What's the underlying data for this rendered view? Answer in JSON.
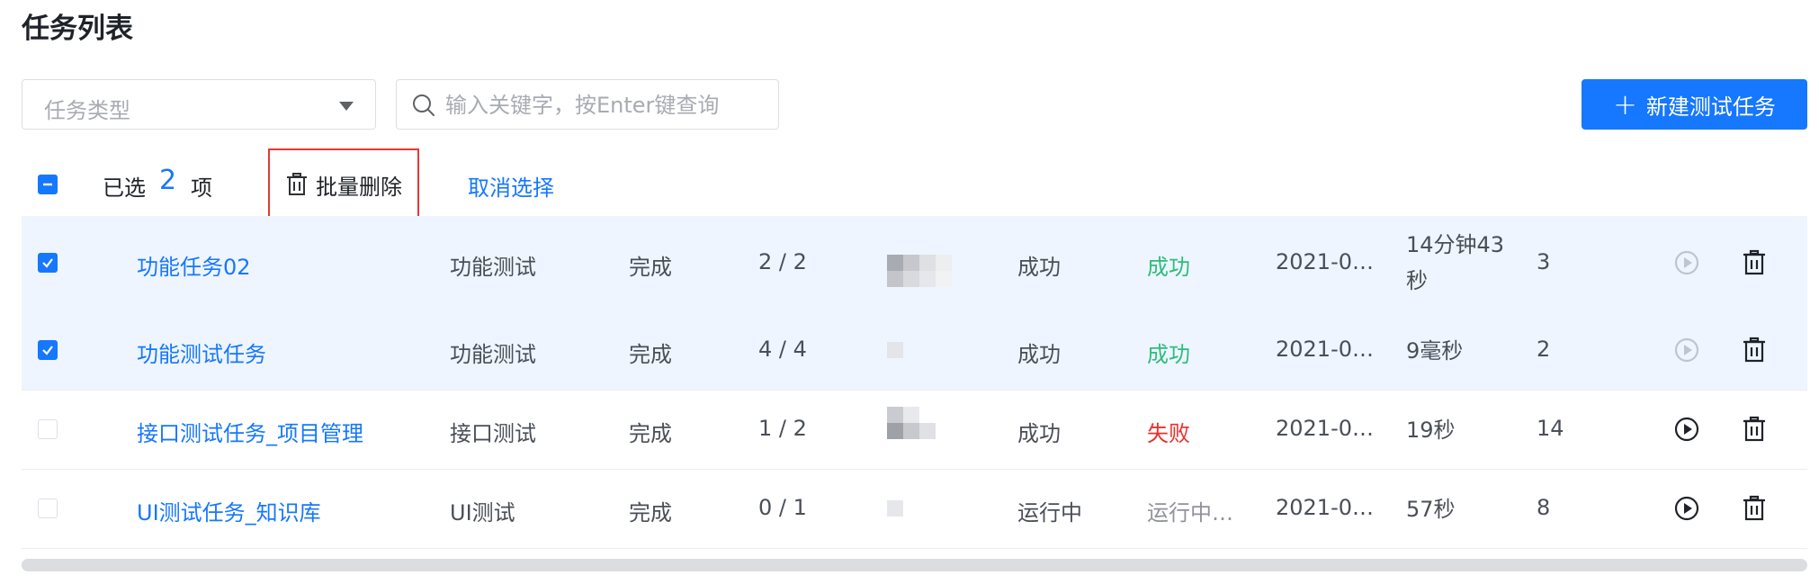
{
  "page": {
    "title": "任务列表"
  },
  "filters": {
    "task_type_placeholder": "任务类型",
    "search_placeholder": "输入关键字，按Enter键查询",
    "new_button_label": "新建测试任务"
  },
  "selection": {
    "prefix": "已选",
    "count": "2",
    "suffix": "项",
    "batch_delete_label": "批量删除",
    "cancel_label": "取消选择"
  },
  "colors": {
    "accent": "#1677ff",
    "success": "#2ebd7c",
    "failure": "#e5322d",
    "highlight_border": "#e53935"
  },
  "rows": [
    {
      "checked": true,
      "name": "功能任务02",
      "type": "功能测试",
      "state": "完成",
      "progress": "2 / 2",
      "exec_status": "成功",
      "result": "成功",
      "result_kind": "ok",
      "time": "2021-0…",
      "duration": "14分钟43秒",
      "count": "3",
      "play_enabled": false
    },
    {
      "checked": true,
      "name": "功能测试任务",
      "type": "功能测试",
      "state": "完成",
      "progress": "4 / 4",
      "exec_status": "成功",
      "result": "成功",
      "result_kind": "ok",
      "time": "2021-0…",
      "duration": "9毫秒",
      "count": "2",
      "play_enabled": false
    },
    {
      "checked": false,
      "name": "接口测试任务_项目管理",
      "type": "接口测试",
      "state": "完成",
      "progress": "1 / 2",
      "exec_status": "成功",
      "result": "失败",
      "result_kind": "fail",
      "time": "2021-0…",
      "duration": "19秒",
      "count": "14",
      "play_enabled": true
    },
    {
      "checked": false,
      "name": "UI测试任务_知识库",
      "type": "UI测试",
      "state": "完成",
      "progress": "0 / 1",
      "exec_status": "运行中",
      "result": "运行中…",
      "result_kind": "run",
      "time": "2021-0…",
      "duration": "57秒",
      "count": "8",
      "play_enabled": true
    }
  ],
  "icons": {
    "search": "search-icon",
    "caret": "chevron-down-icon",
    "trash": "trash-icon",
    "play": "play-icon",
    "plus": "plus-icon"
  }
}
